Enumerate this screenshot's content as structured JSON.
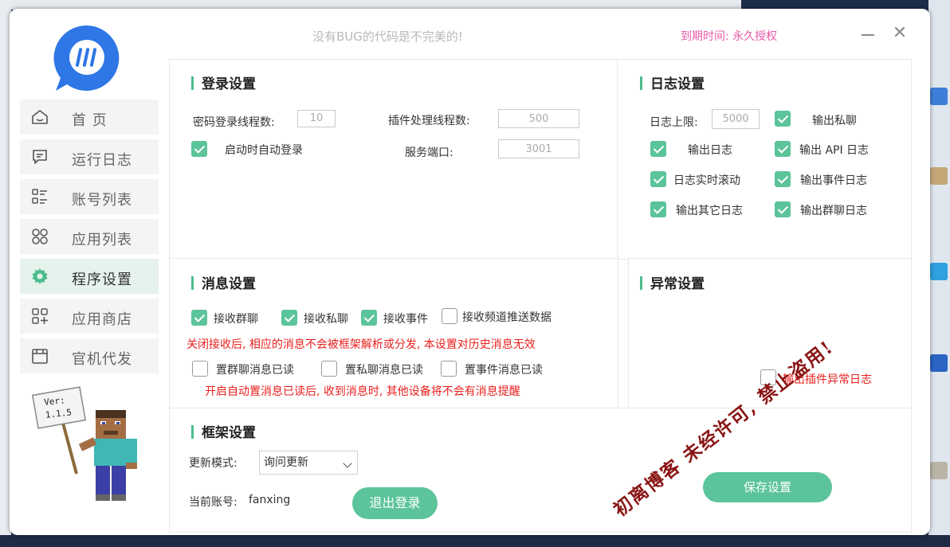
{
  "window": {
    "slogan": "没有BUG的代码是不完美的!",
    "expire_text": "到期时间: 永久授权",
    "close_symbol": "✕"
  },
  "sidebar": {
    "items": [
      {
        "label": "首 页",
        "icon": "home-icon"
      },
      {
        "label": "运行日志",
        "icon": "message-icon"
      },
      {
        "label": "账号列表",
        "icon": "list-icon"
      },
      {
        "label": "应用列表",
        "icon": "grid-icon"
      },
      {
        "label": "程序设置",
        "icon": "gear-icon",
        "active": true
      },
      {
        "label": "应用商店",
        "icon": "store-icon"
      },
      {
        "label": "官机代发",
        "icon": "calendar-icon"
      }
    ],
    "version_sign": "Ver:\n1.1.5",
    "version_line1": "Ver:",
    "version_line2": "1.1.5"
  },
  "login": {
    "title": "登录设置",
    "pwd_threads_label": "密码登录线程数:",
    "pwd_threads_value": "10",
    "plugin_threads_label": "插件处理线程数:",
    "plugin_threads_value": "500",
    "auto_login_label": "启动时自动登录",
    "auto_login_checked": true,
    "port_label": "服务端口:",
    "port_value": "3001"
  },
  "log": {
    "title": "日志设置",
    "limit_label": "日志上限:",
    "limit_value": "5000",
    "opt_private": "输出私聊",
    "opt_log": "输出日志",
    "opt_api": "输出 API 日志",
    "opt_scroll": "日志实时滚动",
    "opt_event": "输出事件日志",
    "opt_other": "输出其它日志",
    "opt_group": "输出群聊日志"
  },
  "message": {
    "title": "消息设置",
    "recv_group": "接收群聊",
    "recv_private": "接收私聊",
    "recv_event": "接收事件",
    "recv_channel": "接收频道推送数据",
    "warn1": "关闭接收后, 相应的消息不会被框架解析或分发, 本设置对历史消息无效",
    "read_group": "置群聊消息已读",
    "read_private": "置私聊消息已读",
    "read_event": "置事件消息已读",
    "warn2": "开启自动置消息已读后, 收到消息时, 其他设备将不会有消息提醒"
  },
  "exception": {
    "title": "异常设置",
    "plugin_log": "输出插件异常日志"
  },
  "framework": {
    "title": "框架设置",
    "update_label": "更新模式:",
    "update_value": "询问更新",
    "account_label": "当前账号:",
    "account_value": "fanxing",
    "logout_button": "退出登录"
  },
  "save_button": "保存设置",
  "watermark": "初离博客 未经许可, 禁止盗用!",
  "colors": {
    "accent": "#5cc49a",
    "warning": "#e8211f",
    "expire": "#e85aa8",
    "watermark": "#8a1414"
  }
}
